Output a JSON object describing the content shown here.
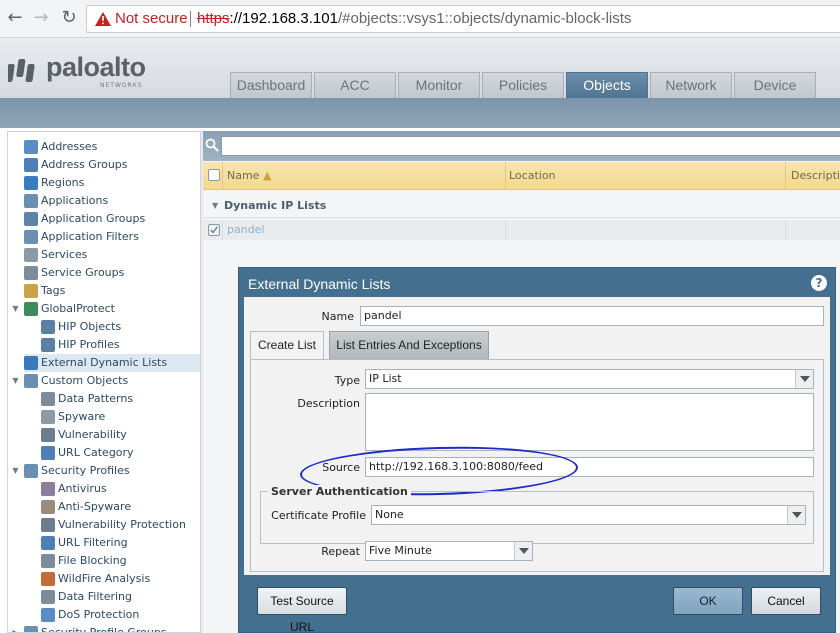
{
  "browser": {
    "not_secure": "Not secure",
    "url_scheme": "https",
    "url_host": "://192.168.3.101",
    "url_path": "/#objects::vsys1::objects/dynamic-block-lists"
  },
  "brand": {
    "name": "paloalto",
    "sub": "NETWORKS"
  },
  "tabs": [
    "Dashboard",
    "ACC",
    "Monitor",
    "Policies",
    "Objects",
    "Network",
    "Device"
  ],
  "active_tab": "Objects",
  "sidebar": {
    "items": [
      {
        "label": "Addresses",
        "icon": "addresses-icon"
      },
      {
        "label": "Address Groups",
        "icon": "address-groups-icon"
      },
      {
        "label": "Regions",
        "icon": "regions-icon"
      },
      {
        "label": "Applications",
        "icon": "applications-icon"
      },
      {
        "label": "Application Groups",
        "icon": "application-groups-icon"
      },
      {
        "label": "Application Filters",
        "icon": "application-filters-icon"
      },
      {
        "label": "Services",
        "icon": "services-icon"
      },
      {
        "label": "Service Groups",
        "icon": "service-groups-icon"
      },
      {
        "label": "Tags",
        "icon": "tags-icon"
      },
      {
        "label": "GlobalProtect",
        "icon": "globalprotect-icon"
      },
      {
        "label": "HIP Objects",
        "icon": "hip-objects-icon"
      },
      {
        "label": "HIP Profiles",
        "icon": "hip-profiles-icon"
      },
      {
        "label": "External Dynamic Lists",
        "icon": "external-dynamic-lists-icon"
      },
      {
        "label": "Custom Objects",
        "icon": "custom-objects-icon"
      },
      {
        "label": "Data Patterns",
        "icon": "data-patterns-icon"
      },
      {
        "label": "Spyware",
        "icon": "spyware-icon"
      },
      {
        "label": "Vulnerability",
        "icon": "vulnerability-icon"
      },
      {
        "label": "URL Category",
        "icon": "url-category-icon"
      },
      {
        "label": "Security Profiles",
        "icon": "security-profiles-icon"
      },
      {
        "label": "Antivirus",
        "icon": "antivirus-icon"
      },
      {
        "label": "Anti-Spyware",
        "icon": "anti-spyware-icon"
      },
      {
        "label": "Vulnerability Protection",
        "icon": "vulnerability-protection-icon"
      },
      {
        "label": "URL Filtering",
        "icon": "url-filtering-icon"
      },
      {
        "label": "File Blocking",
        "icon": "file-blocking-icon"
      },
      {
        "label": "WildFire Analysis",
        "icon": "wildfire-analysis-icon"
      },
      {
        "label": "Data Filtering",
        "icon": "data-filtering-icon"
      },
      {
        "label": "DoS Protection",
        "icon": "dos-protection-icon"
      },
      {
        "label": "Security Profile Groups",
        "icon": "security-profile-groups-icon"
      }
    ]
  },
  "grid": {
    "columns": [
      "Name",
      "Location",
      "Description"
    ],
    "group": "Dynamic IP Lists",
    "rows": [
      {
        "name": "pandel"
      }
    ]
  },
  "dialog": {
    "title": "External Dynamic Lists",
    "name_label": "Name",
    "name_value": "pandel",
    "tabs": [
      "Create List",
      "List Entries And Exceptions"
    ],
    "type_label": "Type",
    "type_value": "IP List",
    "description_label": "Description",
    "description_value": "",
    "source_label": "Source",
    "source_value": "http://192.168.3.100:8080/feed",
    "server_auth_legend": "Server Authentication",
    "cert_profile_label": "Certificate Profile",
    "cert_profile_value": "None",
    "repeat_label": "Repeat",
    "repeat_value": "Five Minute",
    "test_button": "Test Source URL",
    "ok_button": "OK",
    "cancel_button": "Cancel"
  },
  "colors": {
    "header_blue": "#456f8e",
    "active_tab": "#5b7f9c",
    "grid_header": "#f3d98e",
    "annotation": "#1d2bc7",
    "not_secure": "#c5221f"
  }
}
